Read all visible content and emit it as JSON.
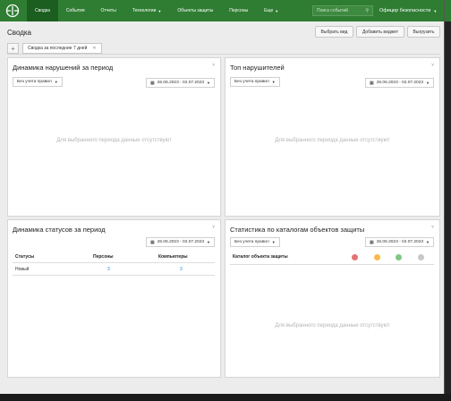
{
  "nav": {
    "items": [
      {
        "label": "Сводка",
        "active": true
      },
      {
        "label": "События",
        "active": false
      },
      {
        "label": "Отчеты",
        "active": false
      },
      {
        "label": "Технологии",
        "active": false,
        "dropdown": true
      },
      {
        "label": "Объекты защиты",
        "active": false
      },
      {
        "label": "Персоны",
        "active": false
      },
      {
        "label": "Еще",
        "active": false,
        "dropdown": true
      }
    ],
    "search_placeholder": "Поиск событий",
    "user": "Офицер безопасности"
  },
  "page": {
    "title": "Сводка",
    "buttons": {
      "choose_view": "Выбрать вид",
      "add_widget": "Добавить виджет",
      "export": "Выгрузить"
    },
    "tab_label": "Сводка за последние 7 дней"
  },
  "widgets": {
    "violations": {
      "title": "Динамика нарушений за период",
      "filter": "Без учета правил",
      "date": "26.06.2023 - 02.07.2023",
      "empty": "Для выбранного периода данные отсутствуют"
    },
    "top": {
      "title": "Топ нарушителей",
      "filter": "Без учета правил",
      "date": "26.06.2023 - 02.07.2023",
      "empty": "Для выбранного периода данные отсутствуют"
    },
    "statuses": {
      "title": "Динамика статусов за период",
      "date": "26.06.2023 - 02.07.2023",
      "columns": [
        "Статусы",
        "Персоны",
        "Компьютеры"
      ],
      "rows": [
        {
          "status": "Новый",
          "persons": "3",
          "computers": "3"
        }
      ]
    },
    "catalog": {
      "title": "Статистика по каталогам объектов защиты",
      "filter": "Без учета правил",
      "date": "26.06.2023 - 02.07.2023",
      "column": "Каталог объекта защиты",
      "dot_colors": [
        "#e57373",
        "#ffb74d",
        "#81c784",
        "#c8c8c8"
      ],
      "empty": "Для выбранного периода данные отсутствуют"
    }
  },
  "colors": {
    "nav": "#2e7d32",
    "nav_active": "#1b5e20",
    "link": "#1e88e5"
  }
}
